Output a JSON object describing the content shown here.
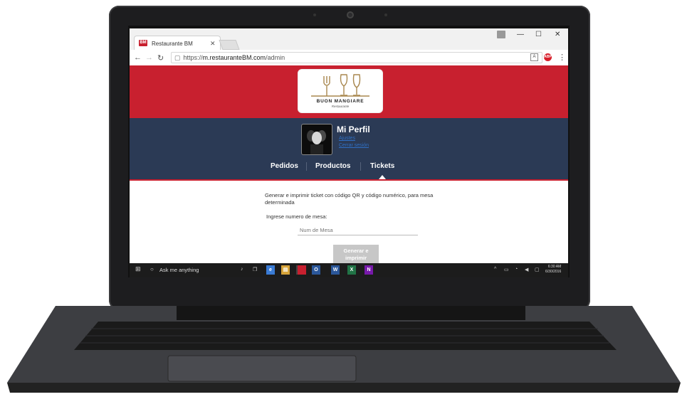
{
  "browser": {
    "tab_title": "Restaurante BM",
    "favicon_text": "BM",
    "url_scheme": "https://",
    "url_host": "m.restauranteBM.com",
    "url_path": "/admin",
    "abp_label": "ABP"
  },
  "header": {
    "logo_title": "BUON MANGIARE",
    "logo_subtitle": "Restaurante"
  },
  "profile": {
    "title": "Mi Perfil",
    "link_1": "Ajustes",
    "link_2": "Cerrar sesión"
  },
  "nav": {
    "items": [
      {
        "label": "Pedidos"
      },
      {
        "label": "Productos"
      },
      {
        "label": "Tickets"
      }
    ],
    "active": "Tickets"
  },
  "tickets": {
    "description": "Generar e imprimir ticket con código QR y código numérico, para mesa determinada",
    "mesa_label": "Ingrese numero de mesa:",
    "mesa_placeholder": "Num de Mesa",
    "button_label": "Generar e imprimir"
  },
  "taskbar": {
    "search_text": "Ask me anything",
    "time": "6:30 AM",
    "date": "6/30/2016"
  },
  "colors": {
    "brand_red": "#c8202f",
    "navy": "#2b3a55",
    "button_disabled": "#c7c7c7"
  }
}
